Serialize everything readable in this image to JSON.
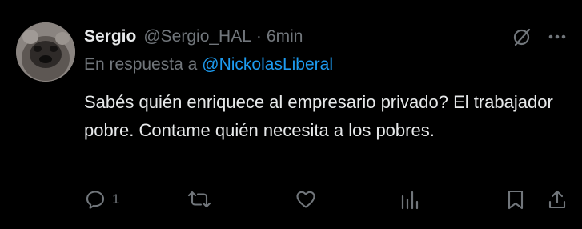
{
  "tweet": {
    "author_name": "Sergio",
    "handle": "@Sergio_HAL",
    "separator": "·",
    "time": "6min",
    "reply_prefix": "En respuesta a",
    "reply_mention": "@NickolasLiberal",
    "body": "Sabés quién enriquece al empresario privado? El trabajador pobre. Contame quién necesita a los pobres.",
    "avatar_icon": "user-avatar-photo"
  },
  "top_actions": {
    "grok_icon": "slashed-circle-icon",
    "more_icon": "more-horizontal-icon"
  },
  "actions": {
    "reply_count": "1",
    "reply_icon": "reply-icon",
    "retweet_icon": "retweet-icon",
    "like_icon": "heart-icon",
    "views_icon": "views-bar-chart-icon",
    "bookmark_icon": "bookmark-icon",
    "share_icon": "share-icon"
  },
  "colors": {
    "background": "#000000",
    "text": "#e7e9ea",
    "muted": "#71767b",
    "link": "#1d9bf0"
  }
}
